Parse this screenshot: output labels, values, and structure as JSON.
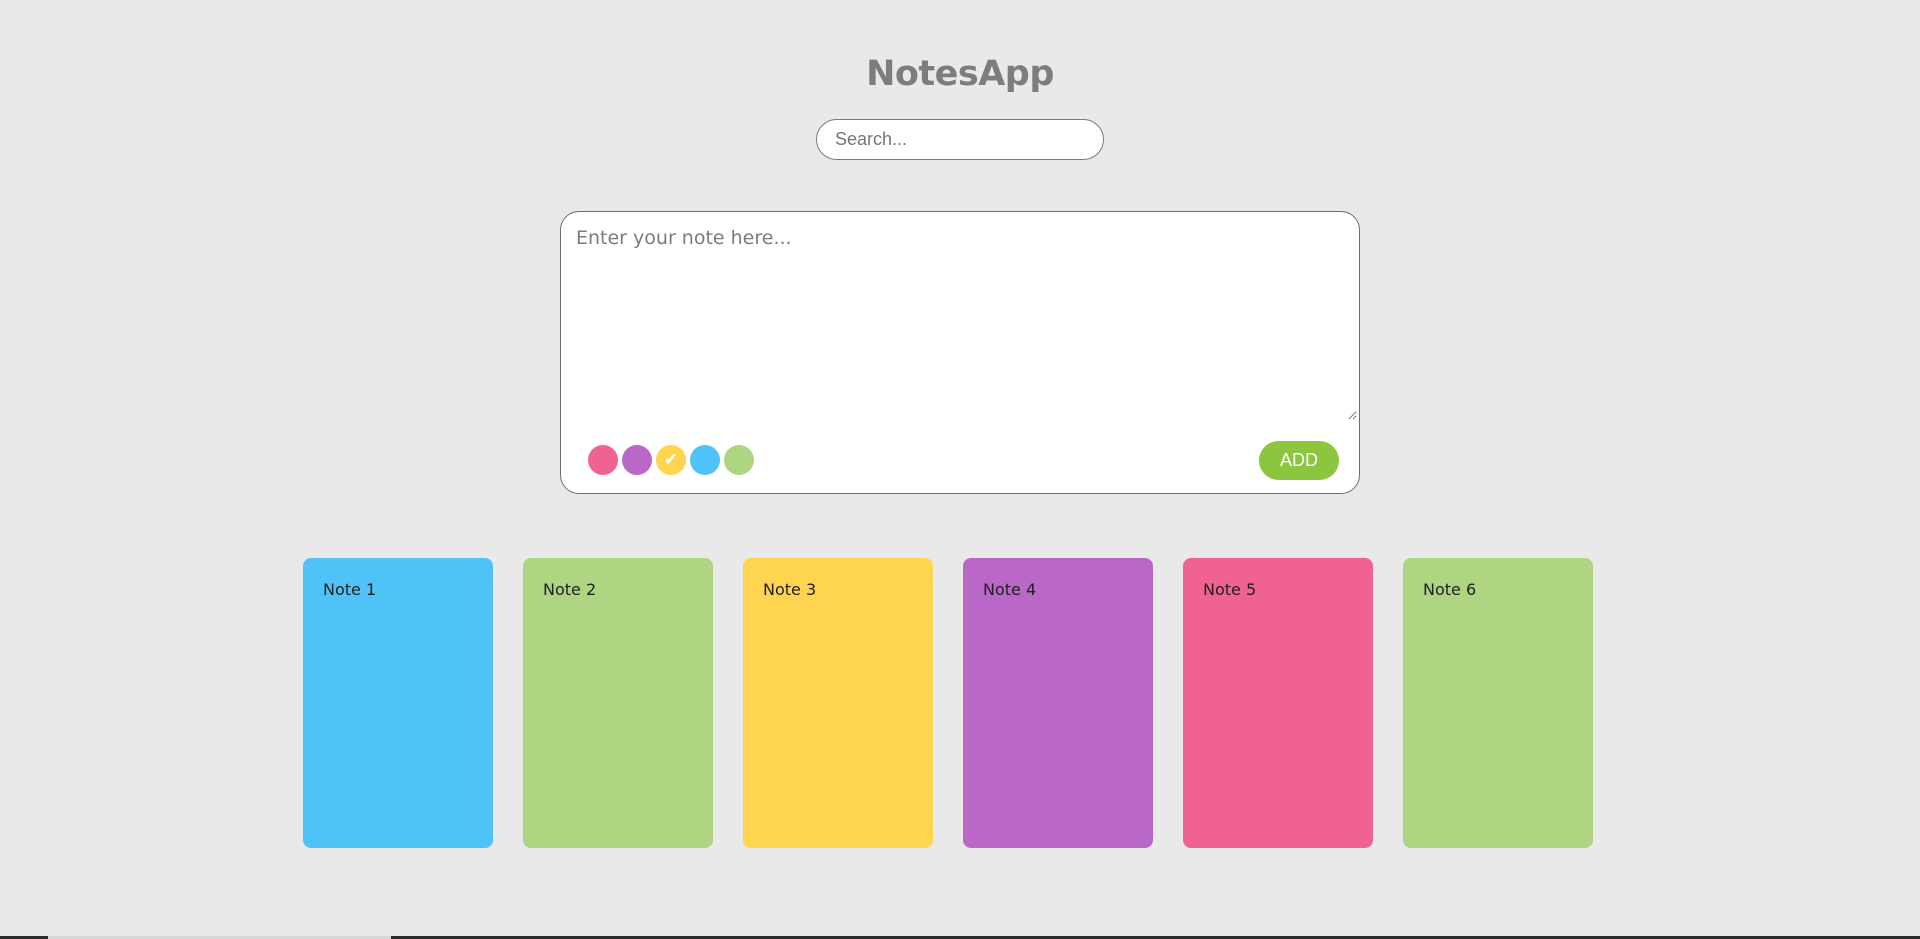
{
  "app": {
    "title": "NotesApp"
  },
  "search": {
    "placeholder": "Search...",
    "value": ""
  },
  "composer": {
    "placeholder": "Enter your note here...",
    "value": "",
    "add_label": "ADD",
    "colors": [
      {
        "name": "pink",
        "hex": "#f06292",
        "selected": false
      },
      {
        "name": "purple",
        "hex": "#ba68c8",
        "selected": false
      },
      {
        "name": "yellow",
        "hex": "#ffd54f",
        "selected": true
      },
      {
        "name": "blue",
        "hex": "#4fc3f7",
        "selected": false
      },
      {
        "name": "green",
        "hex": "#aed581",
        "selected": false
      }
    ],
    "selected_check": "✔"
  },
  "notes": [
    {
      "text": "Note 1",
      "color": "#4fc3f7"
    },
    {
      "text": "Note 2",
      "color": "#aed581"
    },
    {
      "text": "Note 3",
      "color": "#ffd54f"
    },
    {
      "text": "Note 4",
      "color": "#ba68c8"
    },
    {
      "text": "Note 5",
      "color": "#f06292"
    },
    {
      "text": "Note 6",
      "color": "#aed581"
    }
  ],
  "theme": {
    "background": "#e9e9e9",
    "accent": "#8cc63f",
    "title_color": "#7d7d7d"
  }
}
